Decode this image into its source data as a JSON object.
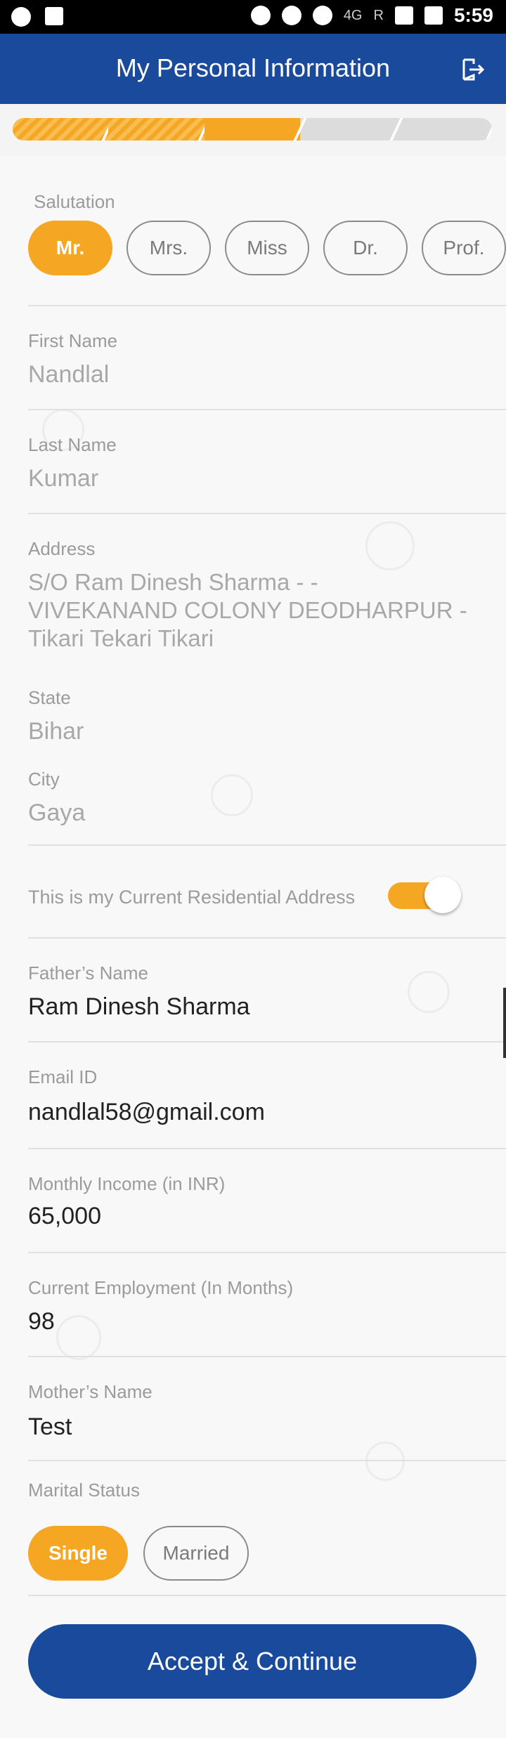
{
  "status_bar": {
    "network": "4G",
    "roaming": "R",
    "time": "5:59"
  },
  "header": {
    "title": "My Personal Information"
  },
  "progress": {
    "steps_total": 5,
    "steps_completed": 3
  },
  "salutation": {
    "label": "Salutation",
    "options": [
      "Mr.",
      "Mrs.",
      "Miss",
      "Dr.",
      "Prof."
    ],
    "selected": "Mr."
  },
  "fields": {
    "first_name": {
      "label": "First Name",
      "value": "Nandlal"
    },
    "last_name": {
      "label": "Last Name",
      "value": "Kumar"
    },
    "address": {
      "label": "Address",
      "lines": [
        "S/O Ram Dinesh Sharma - -",
        "VIVEKANAND COLONY DEODHARPUR -",
        "Tikari Tekari Tikari"
      ]
    },
    "state": {
      "label": "State",
      "value": "Bihar"
    },
    "city": {
      "label": "City",
      "value": "Gaya"
    },
    "current_address_toggle": {
      "label": "This is my Current Residential Address",
      "on": true
    },
    "fathers_name": {
      "label": "Father’s Name",
      "value": "Ram Dinesh Sharma"
    },
    "email": {
      "label": "Email ID",
      "value": "nandlal58@gmail.com"
    },
    "monthly_income": {
      "label": "Monthly Income (in INR)",
      "value": "65,000"
    },
    "current_employment": {
      "label": "Current Employment (In Months)",
      "value": "98"
    },
    "mothers_name": {
      "label": "Mother’s Name",
      "value": "Test"
    }
  },
  "marital_status": {
    "label": "Marital Status",
    "options": [
      "Single",
      "Married"
    ],
    "selected": "Single"
  },
  "footer": {
    "accept_label": "Accept & Continue"
  },
  "colors": {
    "primary": "#1a4a9c",
    "accent": "#f5a623"
  }
}
